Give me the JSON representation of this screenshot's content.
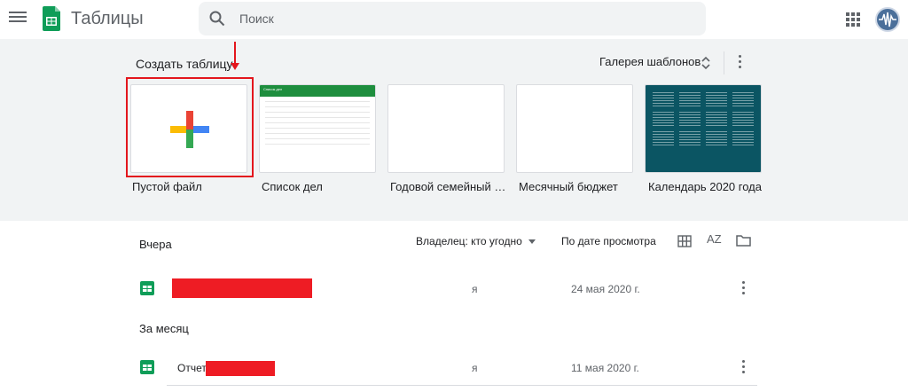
{
  "app": {
    "title": "Таблицы"
  },
  "search": {
    "placeholder": "Поиск"
  },
  "templates": {
    "heading": "Создать таблицу",
    "gallery_label": "Галерея шаблонов",
    "items": [
      {
        "label": "Пустой файл"
      },
      {
        "label": "Список дел",
        "header_text": "Список дел"
      },
      {
        "label": "Годовой семейный б..."
      },
      {
        "label": "Месячный бюджет"
      },
      {
        "label": "Календарь 2020 года"
      }
    ]
  },
  "files": {
    "owner_filter": "Владелец: кто угодно",
    "sort_label": "По дате просмотра",
    "sort_icon_text": "AZ",
    "sections": [
      {
        "label": "Вчера",
        "rows": [
          {
            "name": "",
            "owner": "я",
            "date": "24 мая 2020 г."
          }
        ]
      },
      {
        "label": "За месяц",
        "rows": [
          {
            "name": "Отчет",
            "owner": "я",
            "date": "11 мая 2020 г."
          }
        ]
      }
    ]
  },
  "colors": {
    "accent_green": "#1e8e3e",
    "highlight_red": "#e3161d",
    "template_bg": "#f1f3f4",
    "calendar_bg": "#0b5563"
  },
  "icons": [
    "menu-icon",
    "sheets-logo-icon",
    "search-icon",
    "apps-grid-icon",
    "avatar",
    "unfold-chevron-icon",
    "more-vert-icon",
    "plus-icon",
    "grid-view-icon",
    "sort-az-icon",
    "folder-icon",
    "sheet-file-icon"
  ]
}
